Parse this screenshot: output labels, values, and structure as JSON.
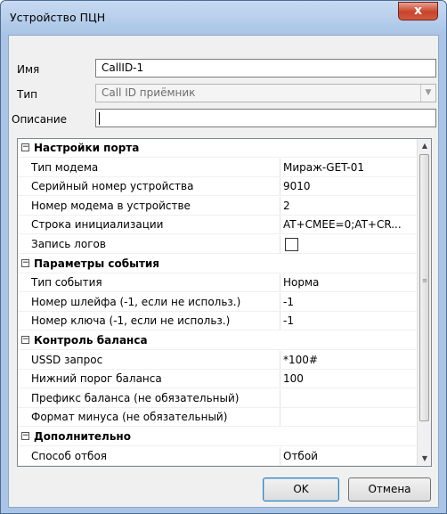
{
  "window": {
    "title": "Устройство ПЦН",
    "close_glyph": "x"
  },
  "form": {
    "name_label": "Имя",
    "name_value": "CallID-1",
    "type_label": "Тип",
    "type_value": "Call ID приёмник",
    "desc_label": "Описание",
    "desc_value": ""
  },
  "grid": {
    "rows": [
      {
        "kind": "cat",
        "name": "Настройки порта",
        "expand": "−"
      },
      {
        "kind": "prop",
        "name": "Тип модема",
        "value": "Мираж-GET-01"
      },
      {
        "kind": "prop",
        "name": "Серийный номер устройства",
        "value": "9010"
      },
      {
        "kind": "prop",
        "name": "Номер модема в устройстве",
        "value": "2"
      },
      {
        "kind": "prop",
        "name": "Строка инициализации",
        "value": "AT+CMEE=0;AT+CR..."
      },
      {
        "kind": "prop",
        "name": "Запись логов",
        "value": "",
        "checkbox": true,
        "checked": false
      },
      {
        "kind": "cat",
        "name": "Параметры события",
        "expand": "−"
      },
      {
        "kind": "prop",
        "name": "Тип события",
        "value": "Норма"
      },
      {
        "kind": "prop",
        "name": "Номер шлейфа (-1, если не использ.)",
        "value": "-1"
      },
      {
        "kind": "prop",
        "name": "Номер ключа (-1, если не использ.)",
        "value": "-1"
      },
      {
        "kind": "cat",
        "name": "Контроль баланса",
        "expand": "−"
      },
      {
        "kind": "prop",
        "name": "USSD запрос",
        "value": "*100#"
      },
      {
        "kind": "prop",
        "name": "Нижний порог баланса",
        "value": "100"
      },
      {
        "kind": "prop",
        "name": "Префикс баланса (не обязательный)",
        "value": ""
      },
      {
        "kind": "prop",
        "name": "Формат минуса (не обязательный)",
        "value": ""
      },
      {
        "kind": "cat",
        "name": "Дополнительно",
        "expand": "−"
      },
      {
        "kind": "prop",
        "name": "Способ отбоя",
        "value": "Отбой"
      }
    ]
  },
  "buttons": {
    "ok": "OK",
    "cancel": "Отмена"
  },
  "icons": {
    "close": "close-icon",
    "dropdown": "chevron-down-icon",
    "scroll_up": "chevron-up-icon",
    "scroll_down": "chevron-down-icon"
  }
}
